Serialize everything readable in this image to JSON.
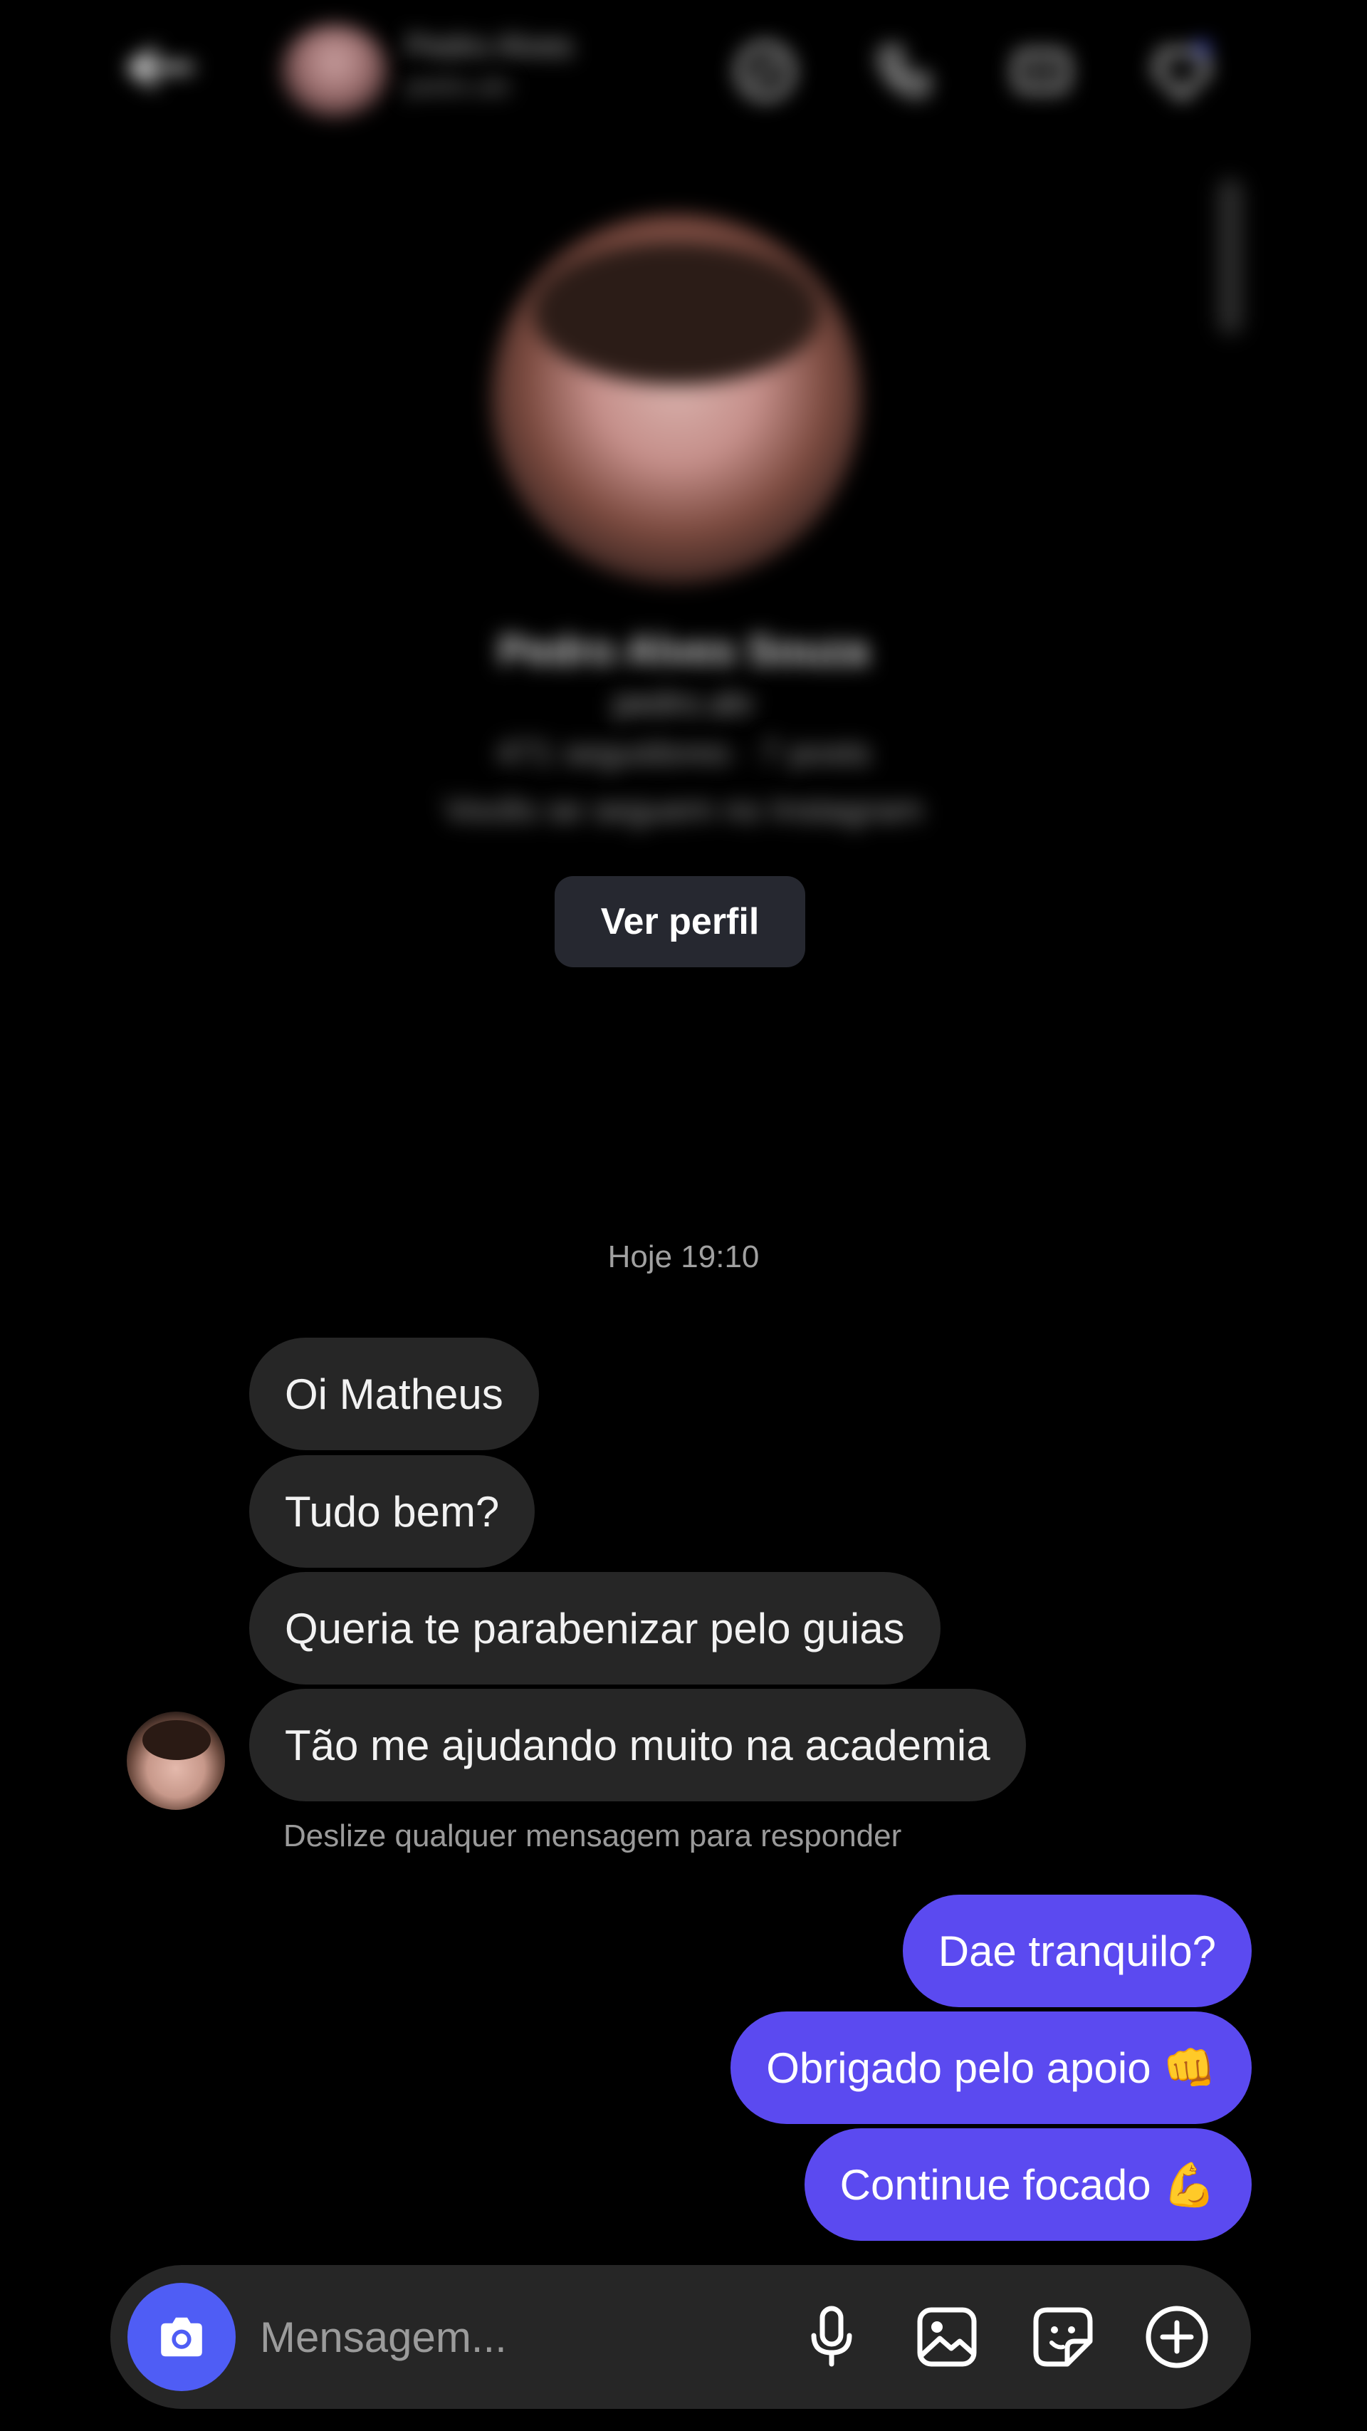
{
  "header": {
    "contact_name": "Pedro Alves",
    "contact_sub": "pedro.alv",
    "icons": [
      "back-arrow-icon",
      "link-icon",
      "phone-icon",
      "video-icon",
      "gem-icon"
    ]
  },
  "profile": {
    "name": "Pedro Alves Souza",
    "username": "pedro.alv",
    "stats": "471 seguidores · 7 posts",
    "follow_note": "Vocês se seguem no Instagram",
    "button_label": "Ver perfil"
  },
  "conversation": {
    "timestamp": "Hoje 19:10",
    "received": [
      "Oi Matheus",
      "Tudo bem?",
      "Queria te parabenizar pelo guias",
      "Tão me ajudando muito na academia"
    ],
    "hint": "Deslize qualquer mensagem para responder",
    "sent": [
      "Dae tranquilo?",
      "Obrigado pelo apoio 👊",
      "Continue focado 💪"
    ]
  },
  "composer": {
    "placeholder": "Mensagem...",
    "icons": [
      "camera-icon",
      "microphone-icon",
      "gallery-icon",
      "sticker-icon",
      "add-icon"
    ]
  },
  "colors": {
    "background": "#000000",
    "received_bubble": "#262626",
    "sent_bubble": "#5b4af0",
    "camera_button": "#4f5df5"
  }
}
